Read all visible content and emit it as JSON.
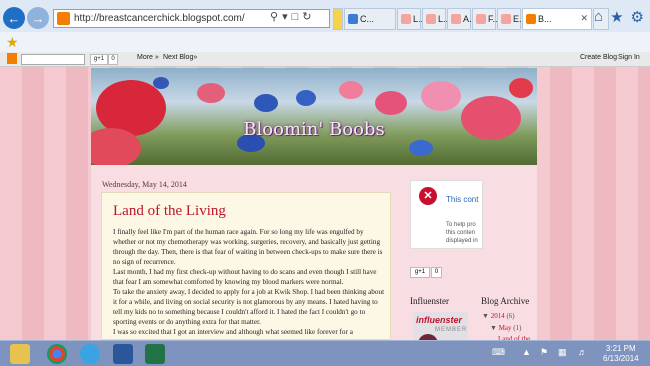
{
  "browser": {
    "url": "http://breastcancerchick.blogspot.com/",
    "tabs": [
      {
        "label": "C..."
      },
      {
        "label": "L..."
      },
      {
        "label": "L..."
      },
      {
        "label": "A..."
      },
      {
        "label": "F..."
      },
      {
        "label": "E..."
      },
      {
        "label": "B..."
      }
    ]
  },
  "navbar": {
    "gplus": "g+1",
    "count": "0",
    "more": "More »",
    "next_blog": "Next Blog»",
    "create_blog": "Create Blog",
    "sign_in": "Sign In"
  },
  "blog": {
    "title": "Bloomin' Boobs"
  },
  "post": {
    "date": "Wednesday, May 14, 2014",
    "title": "Land of the Living",
    "paragraphs": [
      "I finally feel like I'm part of the human race again. For so long my life was engulfed by whether or not my chemotherapy was working, surgeries, recovery, and basically just getting through the day. Then, there is that fear of waiting in between check-ups to make sure there is no sign of recurrence.",
      "Last month, I had my first check-up without having to do scans and even though I still have that fear I am somewhat comforted by knowing my blood markers were normal.",
      "To take the anxiety away, I decided to apply for a job at Kwik Shop. I had been thinking about it for a while, and living on social security is not glamorous by any means. I hated having to tell my kids no to something because I couldn't afford it. I hated the fact I couldn't go to sporting events or do anything extra for that matter.",
      "I was so excited that I got an interview and although what seemed like forever for a"
    ]
  },
  "sidebar": {
    "warning_title": "This cont",
    "warning_text": [
      "To help pro",
      "this conten",
      "displayed in"
    ],
    "gplus": "g+1",
    "gplus_count": "0",
    "influenster_title": "Influenster",
    "influenster_logo": "influenster",
    "influenster_member": "MEMBER",
    "archive_title": "Blog Archive",
    "archive_year": "2014",
    "archive_year_count": "(6)",
    "archive_month": "May",
    "archive_month_count": "(1)",
    "archive_post": "Land of the"
  },
  "taskbar": {
    "time": "3:21 PM",
    "date": "6/13/2014"
  }
}
